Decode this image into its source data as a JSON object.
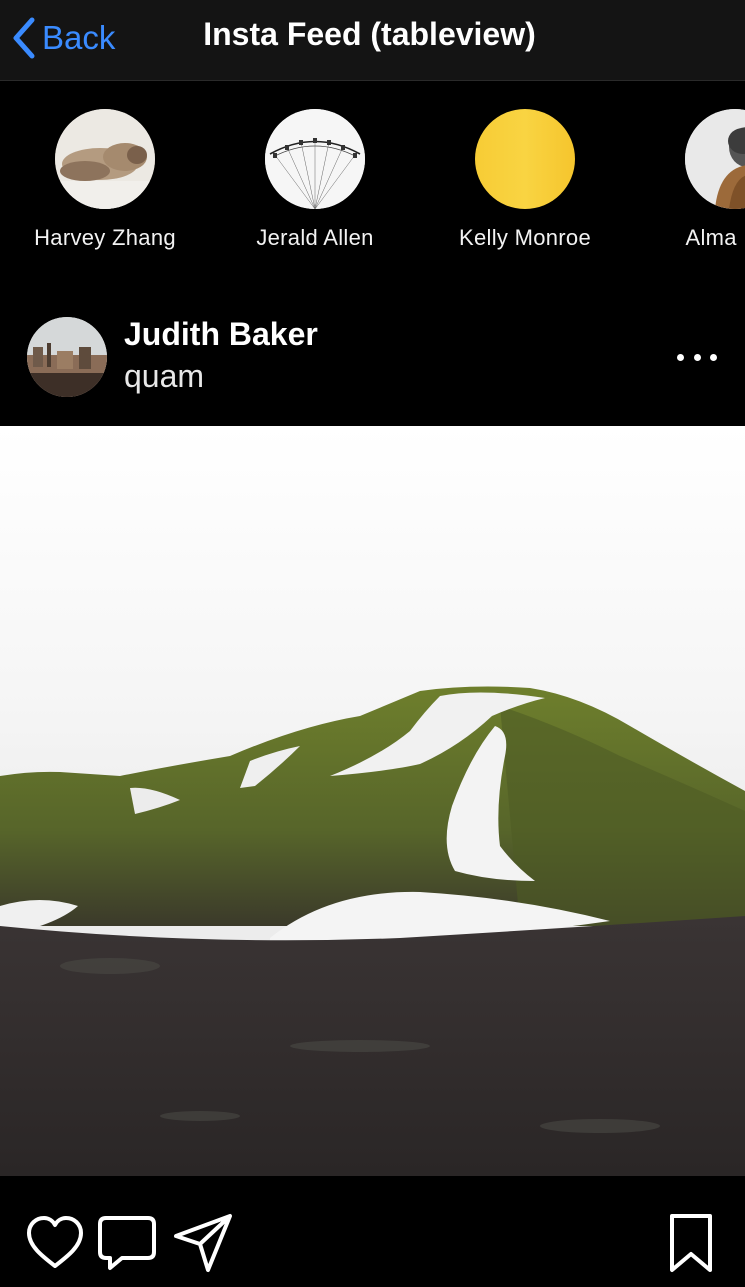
{
  "nav": {
    "back_label": "Back",
    "title": "Insta Feed (tableview)"
  },
  "stories": [
    {
      "name": "Harvey Zhang",
      "avatar": "walrus-photo"
    },
    {
      "name": "Jerald Allen",
      "avatar": "ferris-wheel-photo"
    },
    {
      "name": "Kelly Monroe",
      "avatar": "yellow-photo"
    },
    {
      "name": "Alma Rob",
      "avatar": "person-photo"
    }
  ],
  "post": {
    "user": "Judith Baker",
    "location": "quam",
    "image": "mossy-mountain-photo"
  },
  "actions": {
    "icons": [
      "heart-icon",
      "comment-icon",
      "send-icon",
      "bookmark-icon"
    ]
  },
  "colors": {
    "accent": "#3a8bff",
    "background": "#000000",
    "navbar": "#141414"
  }
}
